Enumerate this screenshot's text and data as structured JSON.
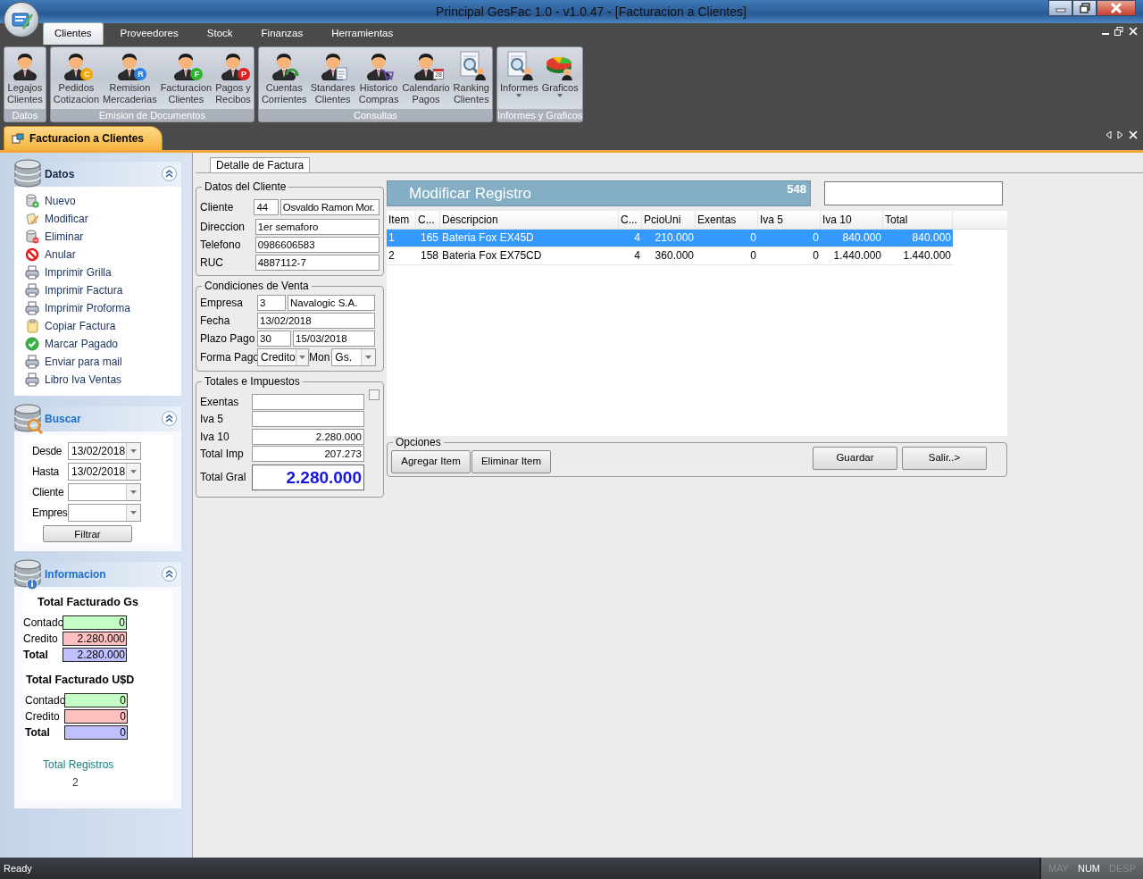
{
  "window": {
    "title": "Principal GesFac 1.0 - v1.0.47 - [Facturacion a Clientes]"
  },
  "ribbon": {
    "tabs": [
      {
        "label": "Clientes",
        "selected": true
      },
      {
        "label": "Proveedores",
        "selected": false
      },
      {
        "label": "Stock",
        "selected": false
      },
      {
        "label": "Finanzas",
        "selected": false
      },
      {
        "label": "Herramientas",
        "selected": false
      }
    ],
    "groups": [
      {
        "label": "Datos",
        "buttons": [
          {
            "lines": [
              "Legajos",
              "Clientes"
            ],
            "kind": "person"
          }
        ]
      },
      {
        "label": "Emision de Documentos",
        "buttons": [
          {
            "lines": [
              "Pedidos",
              "Cotizacion"
            ],
            "kind": "person",
            "badge": "C",
            "color": "#f0a800"
          },
          {
            "lines": [
              "Remision",
              "Mercaderias"
            ],
            "kind": "person",
            "badge": "R",
            "color": "#2a7fe0"
          },
          {
            "lines": [
              "Facturacion",
              "Clientes"
            ],
            "kind": "person",
            "badge": "F",
            "color": "#2fb52f"
          },
          {
            "lines": [
              "Pagos y",
              "Recibos"
            ],
            "kind": "person",
            "badge": "P",
            "color": "#e02020"
          }
        ]
      },
      {
        "label": "Consultas",
        "buttons": [
          {
            "lines": [
              "Cuentas",
              "Corrientes"
            ],
            "kind": "accounts"
          },
          {
            "lines": [
              "Standares",
              "Clientes"
            ],
            "kind": "standards"
          },
          {
            "lines": [
              "Historico",
              "Compras"
            ],
            "kind": "history"
          },
          {
            "lines": [
              "Calendario",
              "Pagos"
            ],
            "kind": "calendar",
            "badge": "28"
          },
          {
            "lines": [
              "Ranking",
              "Clientes"
            ],
            "kind": "report"
          }
        ]
      },
      {
        "label": "Informes y Graficos",
        "buttons": [
          {
            "lines": [
              "Informes"
            ],
            "kind": "report",
            "dropdown": true
          },
          {
            "lines": [
              "Graficos"
            ],
            "kind": "chart",
            "dropdown": true
          }
        ]
      }
    ]
  },
  "document_tabs": [
    {
      "label": "Facturacion a Clientes",
      "selected": true
    }
  ],
  "sidebar": {
    "datos": {
      "title": "Datos",
      "items": [
        {
          "label": "Nuevo",
          "kind": "add"
        },
        {
          "label": "Modificar",
          "kind": "edit"
        },
        {
          "label": "Eliminar",
          "kind": "remove"
        },
        {
          "label": "Anular",
          "kind": "forbid"
        },
        {
          "label": "Imprimir Grilla",
          "kind": "printer"
        },
        {
          "label": "Imprimir Factura",
          "kind": "printer"
        },
        {
          "label": "Imprimir Proforma",
          "kind": "printer"
        },
        {
          "label": "Copiar Factura",
          "kind": "clipboard"
        },
        {
          "label": "Marcar Pagado",
          "kind": "check"
        },
        {
          "label": "Enviar para mail",
          "kind": "printer"
        },
        {
          "label": "Libro Iva Ventas",
          "kind": "printer"
        }
      ]
    },
    "buscar": {
      "title": "Buscar",
      "fields": [
        {
          "label": "Desde",
          "value": "13/02/2018"
        },
        {
          "label": "Hasta",
          "value": "13/02/2018"
        },
        {
          "label": "Cliente"
        },
        {
          "label": "Empres"
        }
      ],
      "button": "Filtrar"
    },
    "informacion": {
      "title": "Informacion",
      "sections": [
        {
          "title": "Total Facturado Gs",
          "rows": [
            {
              "label": "Contado",
              "value": "0",
              "kind": "contado"
            },
            {
              "label": "Credito",
              "value": "2.280.000",
              "kind": "credito"
            },
            {
              "label": "Total",
              "value": "2.280.000",
              "kind": "total"
            }
          ]
        },
        {
          "title": "Total Facturado U$D",
          "rows": [
            {
              "label": "Contado",
              "value": "0",
              "kind": "contado"
            },
            {
              "label": "Credito",
              "value": "0",
              "kind": "credito"
            },
            {
              "label": "Total",
              "value": "0",
              "kind": "total"
            }
          ]
        }
      ],
      "count_label": "Total Registros",
      "count": "2"
    }
  },
  "detail_tab": "Detalle de Factura",
  "cliente": {
    "title": "Datos del Cliente",
    "rows": [
      {
        "label": "Cliente",
        "values": [
          "44",
          "Osvaldo Ramon Mor."
        ]
      },
      {
        "label": "Direccion",
        "values": [
          "1er semaforo"
        ]
      },
      {
        "label": "Telefono",
        "values": [
          "0986606583"
        ]
      },
      {
        "label": "RUC",
        "values": [
          "4887112-7"
        ]
      }
    ]
  },
  "condiciones": {
    "title": "Condiciones de Venta",
    "empresa": {
      "label": "Empresa",
      "values": [
        "3",
        "Navalogic S.A."
      ]
    },
    "fecha": {
      "label": "Fecha",
      "value": "13/02/2018"
    },
    "plazo": {
      "label": "Plazo Pago",
      "values": [
        "30",
        "15/03/2018"
      ]
    },
    "forma": {
      "label": "Forma Pago",
      "value": "Credito",
      "moneda_label": "Mon",
      "moneda": "Gs."
    }
  },
  "totales": {
    "title": "Totales e Impuestos",
    "checked": false,
    "rows": [
      {
        "label": "Exentas"
      },
      {
        "label": "Iva 5"
      },
      {
        "label": "Iva 10",
        "value": "2.280.000"
      },
      {
        "label": "Total Imp",
        "value": "207.273"
      },
      {
        "label": "Total Gral",
        "value": "2.280.000",
        "kind": "grand"
      }
    ]
  },
  "header": {
    "title": "Modificar Registro",
    "number": "548"
  },
  "table": {
    "columns": [
      {
        "label": "Item",
        "kind": "text"
      },
      {
        "label": "C...",
        "kind": "number"
      },
      {
        "label": "Descripcion",
        "kind": "text"
      },
      {
        "label": "C...",
        "kind": "number"
      },
      {
        "label": "PcioUni",
        "kind": "number"
      },
      {
        "label": "Exentas",
        "kind": "number"
      },
      {
        "label": "Iva 5",
        "kind": "number"
      },
      {
        "label": "Iva 10",
        "kind": "number"
      },
      {
        "label": "Total",
        "kind": "number"
      }
    ],
    "rows": [
      {
        "selected": true,
        "cells": [
          "1",
          "165",
          "Bateria Fox EX45D",
          "4",
          "210.000",
          "0",
          "0",
          "840.000",
          "840.000"
        ]
      },
      {
        "selected": false,
        "cells": [
          "2",
          "158",
          "Bateria Fox EX75CD",
          "4",
          "360.000",
          "0",
          "0",
          "1.440.000",
          "1.440.000"
        ]
      }
    ]
  },
  "opciones": {
    "title": "Opciones",
    "left_buttons": [
      "Agregar Item",
      "Eliminar Item"
    ],
    "right_buttons": [
      "Guardar",
      "Salir..>"
    ]
  },
  "status_bar": {
    "text": "Ready",
    "indicators": [
      {
        "label": "MAY",
        "on": false
      },
      {
        "label": "NUM",
        "on": true
      },
      {
        "label": "DESP",
        "on": false
      }
    ]
  }
}
